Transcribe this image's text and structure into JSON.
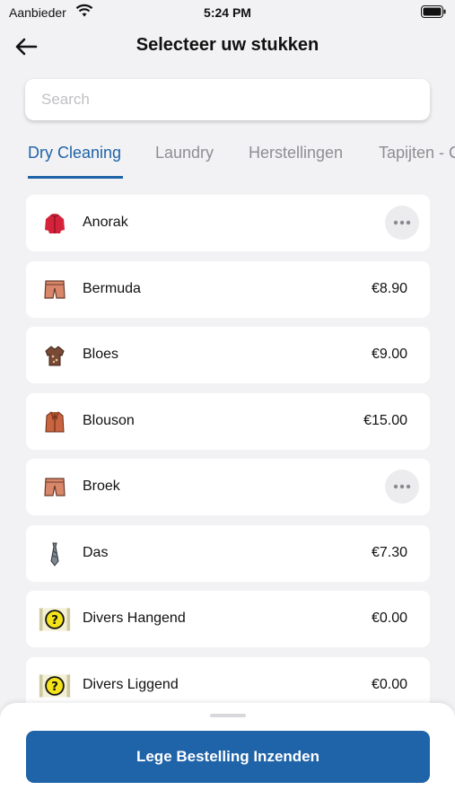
{
  "status_bar": {
    "carrier": "Aanbieder",
    "time": "5:24 PM"
  },
  "header": {
    "title": "Selecteer uw stukken"
  },
  "search": {
    "placeholder": "Search",
    "value": ""
  },
  "tabs": [
    {
      "label": "Dry Cleaning",
      "active": true
    },
    {
      "label": "Laundry",
      "active": false
    },
    {
      "label": "Herstellingen",
      "active": false
    },
    {
      "label": "Tapijten - C",
      "active": false
    }
  ],
  "items": [
    {
      "name": "Anorak",
      "price": "",
      "icon": "jacket-red-icon",
      "has_more": true
    },
    {
      "name": "Bermuda",
      "price": "€8.90",
      "icon": "shorts-icon",
      "has_more": false
    },
    {
      "name": "Bloes",
      "price": "€9.00",
      "icon": "blouse-icon",
      "has_more": false
    },
    {
      "name": "Blouson",
      "price": "€15.00",
      "icon": "blouson-icon",
      "has_more": false
    },
    {
      "name": "Broek",
      "price": "",
      "icon": "trousers-icon",
      "has_more": true
    },
    {
      "name": "Das",
      "price": "€7.30",
      "icon": "tie-icon",
      "has_more": false
    },
    {
      "name": "Divers Hangend",
      "price": "€0.00",
      "icon": "question-icon",
      "has_more": false
    },
    {
      "name": "Divers Liggend",
      "price": "€0.00",
      "icon": "question-icon",
      "has_more": false
    }
  ],
  "footer": {
    "submit_label": "Lege Bestelling Inzenden"
  },
  "colors": {
    "accent": "#1f63a8",
    "background": "#f2f2f4"
  }
}
